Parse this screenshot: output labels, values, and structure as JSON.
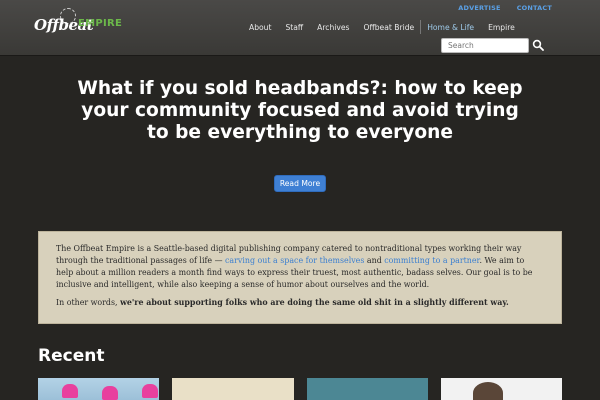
{
  "brand": {
    "logo_word": "Offbeat",
    "logo_suffix": "EMPIRE"
  },
  "util_links": [
    "ADVERTISE",
    "CONTACT"
  ],
  "nav": {
    "items": [
      "About",
      "Staff",
      "Archives",
      "Offbeat Bride"
    ],
    "secondary": [
      "Home & Life",
      "Empire"
    ]
  },
  "search": {
    "placeholder": "Search"
  },
  "hero": {
    "title": "What if you sold headbands?: how to keep your community focused and avoid trying to be everything to everyone",
    "button": "Read More"
  },
  "about": {
    "p1_a": "The Offbeat Empire is a Seattle-based digital publishing company catered to nontraditional types working their way through the traditional passages of life — ",
    "p1_link1": "carving out a space for themselves",
    "p1_b": " and ",
    "p1_link2": "committing to a partner",
    "p1_c": ". We aim to help about a million readers a month find ways to express their truest, most authentic, badass selves. Our goal is to be inclusive and intelligent, while also keeping a sense of humor about ourselves and the world.",
    "p2_a": "In other words, ",
    "p2_strong": "we're about supporting folks who are doing the same old shit in a slightly different way."
  },
  "recent": {
    "heading": "Recent"
  },
  "colors": {
    "accent_blue": "#3f80d4",
    "logo_green": "#6cb84a",
    "background": "#262522",
    "about_bg": "#d8d1bc"
  }
}
